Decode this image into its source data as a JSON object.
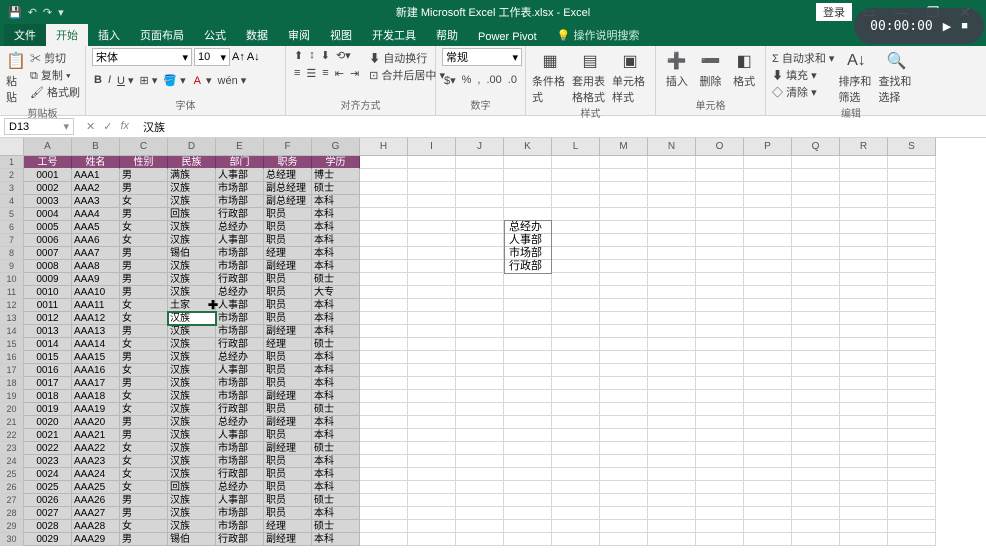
{
  "title": "新建 Microsoft Excel 工作表.xlsx - Excel",
  "login": "登录",
  "timer": "00:00:00",
  "tabs": {
    "file": "文件",
    "home": "开始",
    "insert": "插入",
    "layout": "页面布局",
    "formulas": "公式",
    "data": "数据",
    "review": "审阅",
    "view": "视图",
    "dev": "开发工具",
    "help": "帮助",
    "pp": "Power Pivot",
    "tell": "操作说明搜索"
  },
  "ribbon": {
    "clipboard": {
      "paste": "粘贴",
      "cut": "剪切",
      "copy": "复制",
      "fmt": "格式刷",
      "label": "剪贴板"
    },
    "font": {
      "name": "宋体",
      "size": "10",
      "label": "字体"
    },
    "align": {
      "wrap": "自动换行",
      "merge": "合并后居中",
      "label": "对齐方式"
    },
    "number": {
      "general": "常规",
      "label": "数字"
    },
    "styles": {
      "cond": "条件格式",
      "table": "套用表格格式",
      "cell": "单元格样式",
      "label": "样式"
    },
    "cells": {
      "insert": "插入",
      "delete": "删除",
      "format": "格式",
      "label": "单元格"
    },
    "editing": {
      "sum": "自动求和",
      "fill": "填充",
      "clear": "清除",
      "sort": "排序和筛选",
      "find": "查找和选择",
      "label": "编辑"
    }
  },
  "namebox": "D13",
  "formula": "汉族",
  "columns": [
    "A",
    "B",
    "C",
    "D",
    "E",
    "F",
    "G",
    "H",
    "I",
    "J",
    "K",
    "L",
    "M",
    "N",
    "O",
    "P",
    "Q",
    "R",
    "S"
  ],
  "headers": [
    "工号",
    "姓名",
    "性别",
    "民族",
    "部门",
    "职务",
    "学历"
  ],
  "data": [
    [
      "0001",
      "AAA1",
      "男",
      "满族",
      "人事部",
      "总经理",
      "博士"
    ],
    [
      "0002",
      "AAA2",
      "男",
      "汉族",
      "市场部",
      "副总经理",
      "硕士"
    ],
    [
      "0003",
      "AAA3",
      "女",
      "汉族",
      "市场部",
      "副总经理",
      "本科"
    ],
    [
      "0004",
      "AAA4",
      "男",
      "回族",
      "行政部",
      "职员",
      "本科"
    ],
    [
      "0005",
      "AAA5",
      "女",
      "汉族",
      "总经办",
      "职员",
      "本科"
    ],
    [
      "0006",
      "AAA6",
      "女",
      "汉族",
      "人事部",
      "职员",
      "本科"
    ],
    [
      "0007",
      "AAA7",
      "男",
      "锡伯",
      "市场部",
      "经理",
      "本科"
    ],
    [
      "0008",
      "AAA8",
      "男",
      "汉族",
      "市场部",
      "副经理",
      "本科"
    ],
    [
      "0009",
      "AAA9",
      "男",
      "汉族",
      "行政部",
      "职员",
      "硕士"
    ],
    [
      "0010",
      "AAA10",
      "男",
      "汉族",
      "总经办",
      "职员",
      "大专"
    ],
    [
      "0011",
      "AAA11",
      "女",
      "土家",
      "人事部",
      "职员",
      "本科"
    ],
    [
      "0012",
      "AAA12",
      "女",
      "汉族",
      "市场部",
      "职员",
      "本科"
    ],
    [
      "0013",
      "AAA13",
      "男",
      "汉族",
      "市场部",
      "副经理",
      "本科"
    ],
    [
      "0014",
      "AAA14",
      "女",
      "汉族",
      "行政部",
      "经理",
      "硕士"
    ],
    [
      "0015",
      "AAA15",
      "男",
      "汉族",
      "总经办",
      "职员",
      "本科"
    ],
    [
      "0016",
      "AAA16",
      "女",
      "汉族",
      "人事部",
      "职员",
      "本科"
    ],
    [
      "0017",
      "AAA17",
      "男",
      "汉族",
      "市场部",
      "职员",
      "本科"
    ],
    [
      "0018",
      "AAA18",
      "女",
      "汉族",
      "市场部",
      "副经理",
      "本科"
    ],
    [
      "0019",
      "AAA19",
      "女",
      "汉族",
      "行政部",
      "职员",
      "硕士"
    ],
    [
      "0020",
      "AAA20",
      "男",
      "汉族",
      "总经办",
      "副经理",
      "本科"
    ],
    [
      "0021",
      "AAA21",
      "男",
      "汉族",
      "人事部",
      "职员",
      "本科"
    ],
    [
      "0022",
      "AAA22",
      "女",
      "汉族",
      "市场部",
      "副经理",
      "硕士"
    ],
    [
      "0023",
      "AAA23",
      "女",
      "汉族",
      "市场部",
      "职员",
      "本科"
    ],
    [
      "0024",
      "AAA24",
      "女",
      "汉族",
      "行政部",
      "职员",
      "本科"
    ],
    [
      "0025",
      "AAA25",
      "女",
      "回族",
      "总经办",
      "职员",
      "本科"
    ],
    [
      "0026",
      "AAA26",
      "男",
      "汉族",
      "人事部",
      "职员",
      "硕士"
    ],
    [
      "0027",
      "AAA27",
      "男",
      "汉族",
      "市场部",
      "职员",
      "本科"
    ],
    [
      "0028",
      "AAA28",
      "女",
      "汉族",
      "市场部",
      "经理",
      "硕士"
    ],
    [
      "0029",
      "AAA29",
      "男",
      "锡伯",
      "行政部",
      "副经理",
      "本科"
    ]
  ],
  "sideList": [
    "总经办",
    "人事部",
    "市场部",
    "行政部"
  ],
  "activeCell": {
    "row": 12,
    "col": 3
  }
}
